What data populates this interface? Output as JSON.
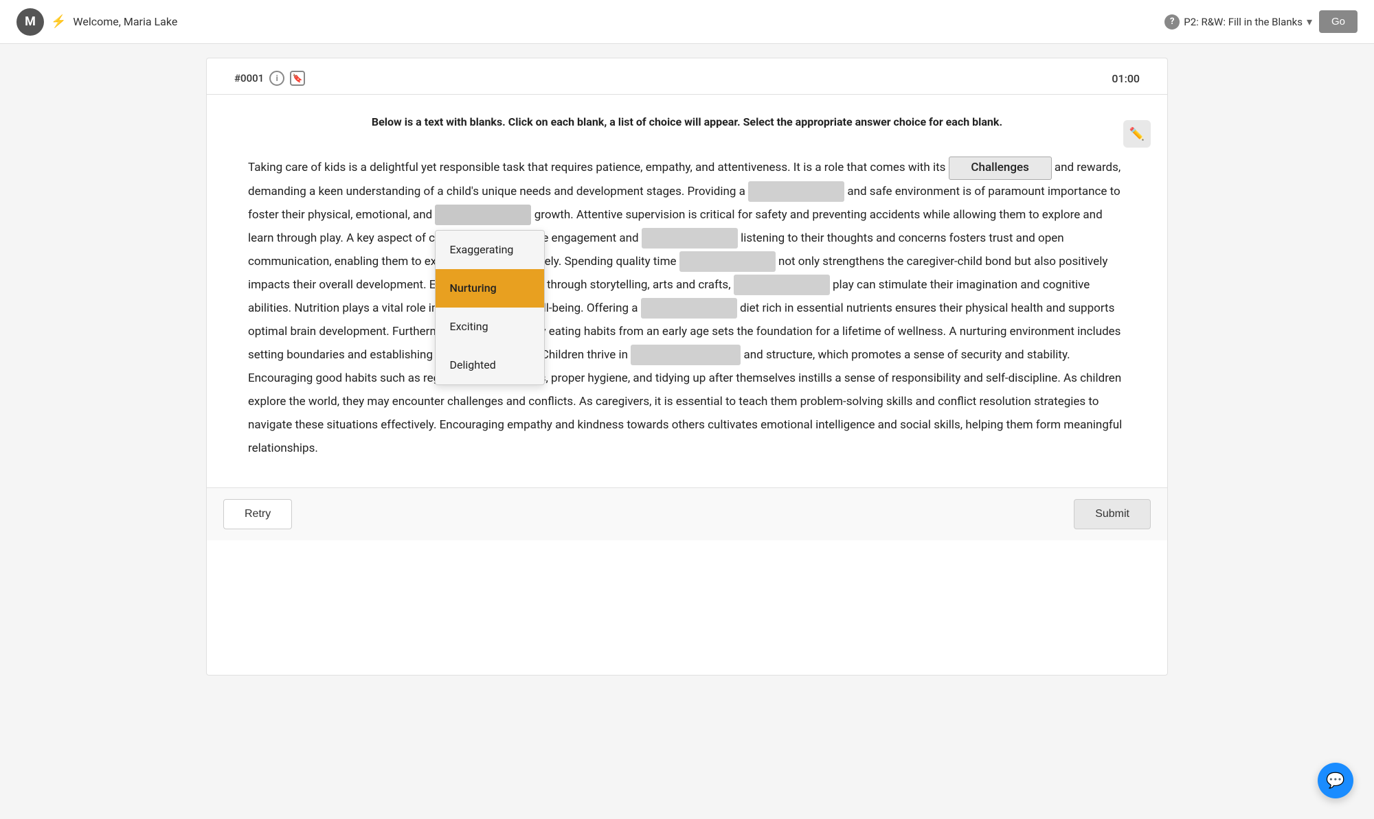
{
  "header": {
    "avatar_letter": "M",
    "welcome_text": "Welcome, Maria Lake",
    "question_type": "P2: R&W: Fill in the Blanks",
    "help_label": "?",
    "go_label": "Go"
  },
  "question": {
    "id": "#0001",
    "timer": "01:00",
    "instruction": "Below is a text with blanks. Click on each blank, a list of choice will appear. Select the appropriate answer choice for each blank."
  },
  "passage": {
    "before_blank1": "Taking care of kids is a delightful yet responsible task that requires patience, empathy, and attentiveness. It is a role that comes with its",
    "blank1_value": "Challenges",
    "after_blank1": "and rewards, demanding a keen understanding of a child's unique needs and development stages. Providing a",
    "blank2_value": "",
    "after_blank2": "and safe environment is of paramount importance to foster their physical, emotional, and",
    "blank3_value": "",
    "after_blank3": "growth. Attentive supervision is critical for safety and preventing accidents while allowing them to explore and learn through play. A key aspect of caring for kids is active engagement and",
    "blank4_value": "",
    "after_blank4": "listening to their thoughts and concerns fosters trust and open communication, enabling them to express themselves freely. Spending quality time",
    "blank5_value": "",
    "after_blank5": "not only strengthens the caregiver-child bond but also positively impacts their overall development. Encouraging creativity through storytelling, arts and crafts,",
    "blank6_value": "",
    "after_blank6": "play can stimulate their imagination and cognitive abilities. Nutrition plays a vital role in their growth and well-being. Offering a",
    "blank7_value": "",
    "after_blank7": "diet rich in essential nutrients ensures their physical health and supports optimal brain development. Furthermore, instilling healthy eating habits from an early age sets the foundation for a lifetime of wellness. A nurturing environment includes setting boundaries and establishing consistent routines. Children thrive in",
    "blank8_value": "",
    "after_blank8": "and structure, which promotes a sense of security and stability. Encouraging good habits such as regular sleep schedules, proper hygiene, and tidying up after themselves instills a sense of responsibility and self-discipline. As children explore the world, they may encounter challenges and conflicts. As caregivers, it is essential to teach them problem-solving skills and conflict resolution strategies to navigate these situations effectively. Encouraging empathy and kindness towards others cultivates emotional intelligence and social skills, helping them form meaningful relationships."
  },
  "dropdown": {
    "options": [
      "Exaggerating",
      "Nurturing",
      "Exciting",
      "Delighted"
    ],
    "selected": "Nurturing",
    "active_blank": "blank3"
  },
  "buttons": {
    "retry": "Retry",
    "submit": "Submit"
  }
}
